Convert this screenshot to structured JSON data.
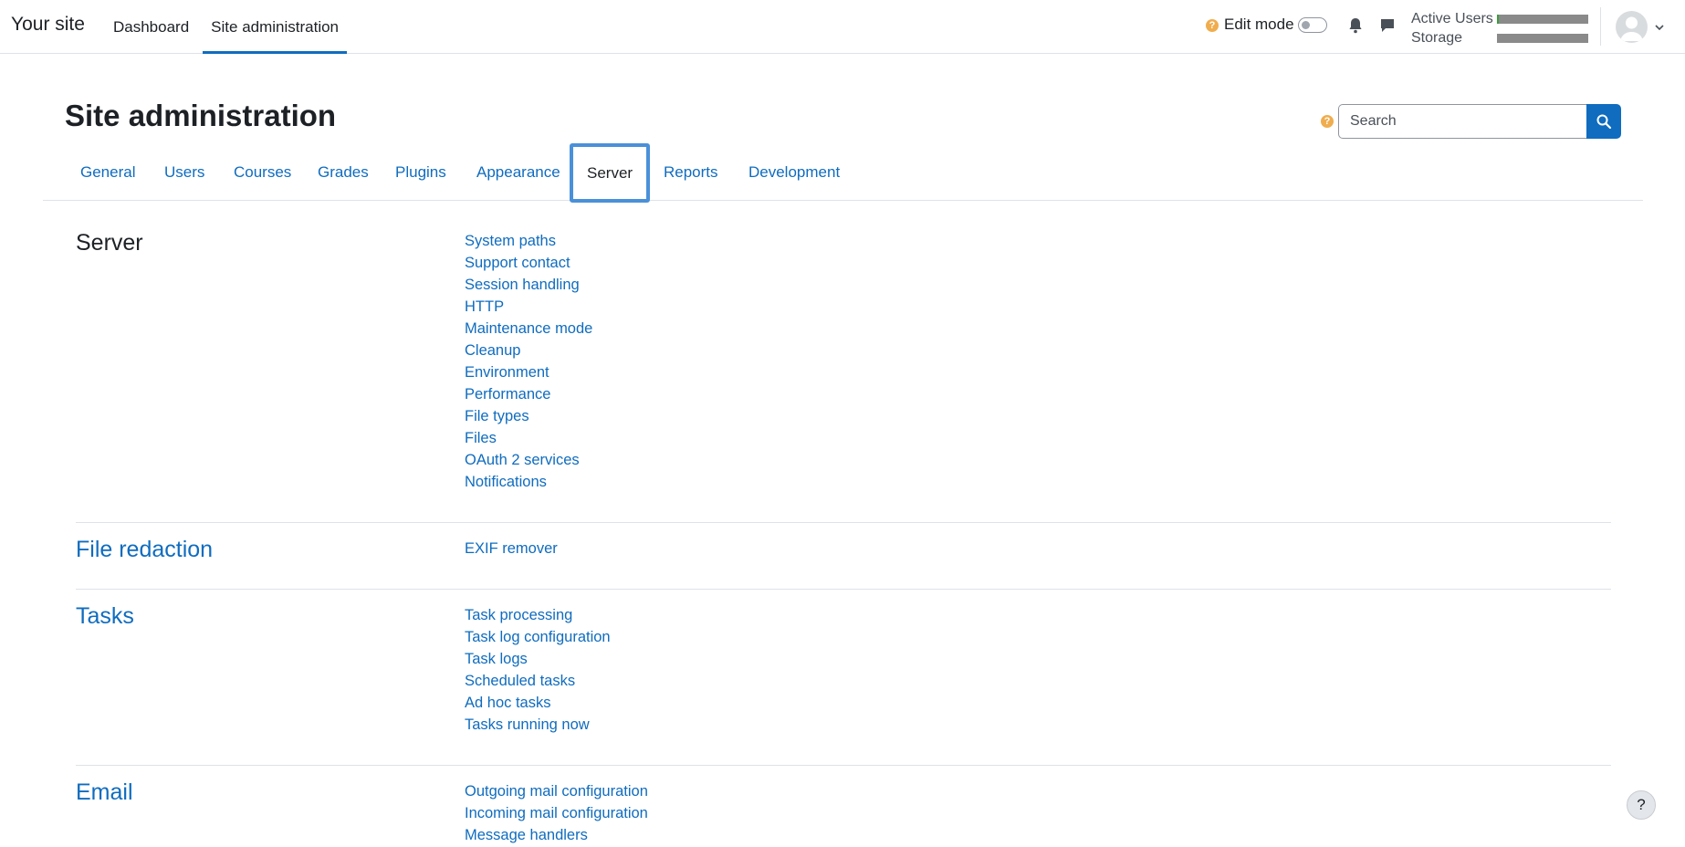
{
  "navbar": {
    "brand": "Your site",
    "items": [
      {
        "label": "Dashboard"
      },
      {
        "label": "Site administration"
      }
    ],
    "edit_mode_label": "Edit mode",
    "usage": {
      "active_users_label": "Active Users",
      "storage_label": "Storage",
      "active_users_fill": 0.02,
      "storage_fill": 0.0
    }
  },
  "page": {
    "title": "Site administration",
    "search_placeholder": "Search"
  },
  "tabs": [
    "General",
    "Users",
    "Courses",
    "Grades",
    "Plugins",
    "Appearance",
    "Server",
    "Reports",
    "Development"
  ],
  "sections": [
    {
      "title": "Server",
      "links": [
        "System paths",
        "Support contact",
        "Session handling",
        "HTTP",
        "Maintenance mode",
        "Cleanup",
        "Environment",
        "Performance",
        "File types",
        "Files",
        "OAuth 2 services",
        "Notifications"
      ]
    },
    {
      "title": "File redaction",
      "links": [
        "EXIF remover"
      ]
    },
    {
      "title": "Tasks",
      "links": [
        "Task processing",
        "Task log configuration",
        "Task logs",
        "Scheduled tasks",
        "Ad hoc tasks",
        "Tasks running now"
      ]
    },
    {
      "title": "Email",
      "links": [
        "Outgoing mail configuration",
        "Incoming mail configuration",
        "Message handlers"
      ]
    }
  ],
  "help_button_label": "?",
  "colors": {
    "link": "#0f6cbf",
    "text": "#1d2125",
    "help": "#f0ad4e",
    "active_tab_border": "#4a90d9"
  }
}
